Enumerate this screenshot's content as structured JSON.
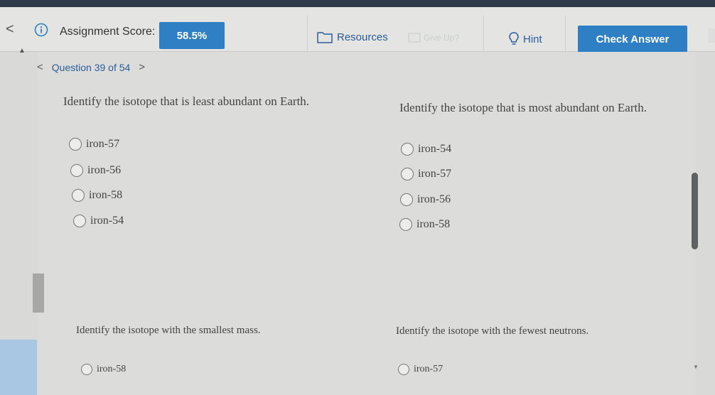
{
  "header": {
    "score_label": "Assignment Score:",
    "score_value": "58.5%",
    "resources_label": "Resources",
    "giveup_label": "Give Up?",
    "hint_label": "Hint",
    "check_answer_label": "Check Answer"
  },
  "nav": {
    "question_label": "Question 39 of 54"
  },
  "questions": [
    {
      "prompt": "Identify the isotope that is least abundant on Earth.",
      "options": [
        "iron-57",
        "iron-56",
        "iron-58",
        "iron-54"
      ]
    },
    {
      "prompt": "Identify the isotope that is most abundant on Earth.",
      "options": [
        "iron-54",
        "iron-57",
        "iron-56",
        "iron-58"
      ]
    },
    {
      "prompt": "Identify the isotope with the smallest mass.",
      "options": [
        "iron-58"
      ]
    },
    {
      "prompt": "Identify the isotope with the fewest neutrons.",
      "options": [
        "iron-57"
      ]
    }
  ],
  "colors": {
    "accent": "#2e7fc4",
    "link": "#2a5d9a"
  }
}
